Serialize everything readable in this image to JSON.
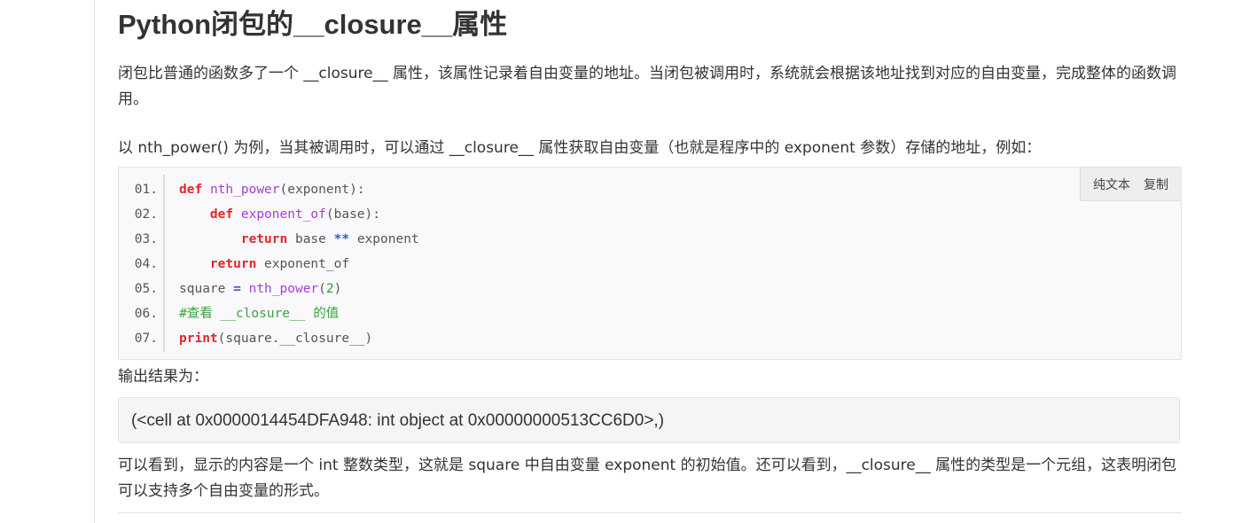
{
  "article": {
    "title": "Python闭包的__closure__属性",
    "p1": "闭包比普通的函数多了一个 __closure__ 属性，该属性记录着自由变量的地址。当闭包被调用时，系统就会根据该地址找到对应的自由变量，完成整体的函数调用。",
    "p2": "以 nth_power() 为例，当其被调用时，可以通过 __closure__ 属性获取自由变量（也就是程序中的 exponent 参数）存储的地址，例如：",
    "p3": "输出结果为：",
    "output": "(<cell at 0x0000014454DFA948: int object at 0x00000000513CC6D0>,)",
    "p4": "可以看到，显示的内容是一个 int 整数类型，这就是 square 中自由变量 exponent 的初始值。还可以看到，__closure__ 属性的类型是一个元组，这表明闭包可以支持多个自由变量的形式。"
  },
  "code_toolbar": {
    "plain_text": "纯文本",
    "copy": "复制"
  },
  "code": {
    "line_numbers": [
      "01.",
      "02.",
      "03.",
      "04.",
      "05.",
      "06.",
      "07."
    ],
    "l1": {
      "kw": "def",
      "fn": "nth_power",
      "rest": "(exponent):"
    },
    "l2": {
      "indent": "    ",
      "kw": "def",
      "fn": "exponent_of",
      "rest": "(base):"
    },
    "l3": {
      "indent": "        ",
      "kw": "return",
      "a": "base",
      "op": "**",
      "b": "exponent"
    },
    "l4": {
      "indent": "    ",
      "kw": "return",
      "rest": "exponent_of"
    },
    "l5": {
      "a": "square",
      "op": "=",
      "fn": "nth_power",
      "open": "(",
      "num": "2",
      "close": ")"
    },
    "l6": {
      "comment": "#查看 __closure__ 的值"
    },
    "l7": {
      "kw": "print",
      "rest": "(square.__closure__)"
    }
  },
  "colors": {
    "keyword": "#e2262a",
    "function": "#a43ed6",
    "operator": "#3355dd",
    "number": "#2f9e2f",
    "comment": "#3aa33a"
  }
}
